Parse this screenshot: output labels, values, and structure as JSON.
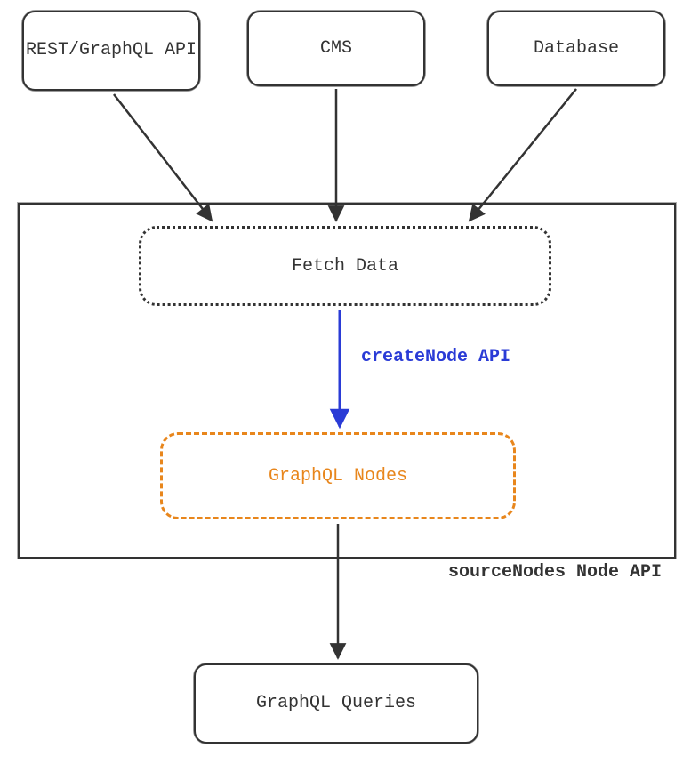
{
  "sources": {
    "rest": "REST/GraphQL API",
    "cms": "CMS",
    "database": "Database"
  },
  "container": {
    "label": "sourceNodes Node API",
    "fetch": "Fetch Data",
    "createNodeLabel": "createNode API",
    "graphqlNodes": "GraphQL Nodes"
  },
  "output": "GraphQL Queries",
  "colors": {
    "stroke": "#333333",
    "blue": "#2a3bd6",
    "orange": "#e8861c"
  }
}
